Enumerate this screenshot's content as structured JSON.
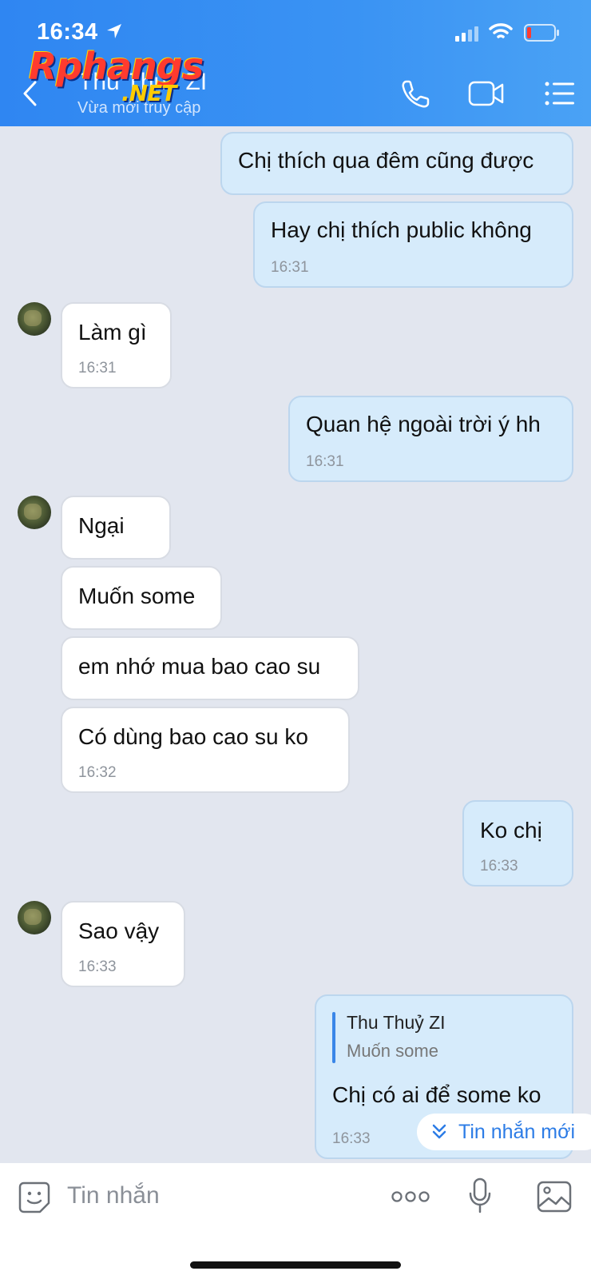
{
  "status_bar": {
    "time": "16:34"
  },
  "header": {
    "contact_name": "Thu Thuỷ ZI",
    "status": "Vừa mới truy cập",
    "watermark": "Rphangs",
    "watermark_suffix": ".NET"
  },
  "messages": [
    {
      "dir": "out",
      "text": "Chị thích qua đêm cũng được",
      "time": ""
    },
    {
      "dir": "out",
      "text": "Hay chị thích public không",
      "time": "16:31"
    },
    {
      "dir": "in",
      "text": "Làm gì",
      "time": "16:31"
    },
    {
      "dir": "out",
      "text": "Quan hệ ngoài trời ý hh",
      "time": "16:31"
    },
    {
      "dir": "in",
      "text": "Ngại",
      "time": ""
    },
    {
      "dir": "in",
      "text": "Muốn some",
      "time": ""
    },
    {
      "dir": "in",
      "text": "em nhớ mua bao cao su",
      "time": ""
    },
    {
      "dir": "in",
      "text": "Có dùng bao cao su ko",
      "time": "16:32"
    },
    {
      "dir": "out",
      "text": "Ko chị",
      "time": "16:33"
    },
    {
      "dir": "in",
      "text": "Sao vậy",
      "time": "16:33"
    }
  ],
  "reply_message": {
    "quoted_name": "Thu Thuỷ ZI",
    "quoted_text": "Muốn some",
    "text": "Chị có ai để some ko",
    "time": "16:33"
  },
  "new_messages_button": {
    "label": "Tin nhắn mới",
    "icon": "double-chevron-down-icon"
  },
  "composer": {
    "placeholder": "Tin nhắn"
  },
  "icons": {
    "call": "phone-icon",
    "video": "video-camera-icon",
    "menu": "list-menu-icon",
    "sticker": "sticker-icon",
    "more": "more-dots-icon",
    "mic": "microphone-icon",
    "image": "image-icon"
  },
  "colors": {
    "header": "#3a93f3",
    "outgoing_bubble": "#d6ebfb",
    "incoming_bubble": "#ffffff",
    "chat_background": "#e2e6ef",
    "accent": "#2c7ce6"
  }
}
